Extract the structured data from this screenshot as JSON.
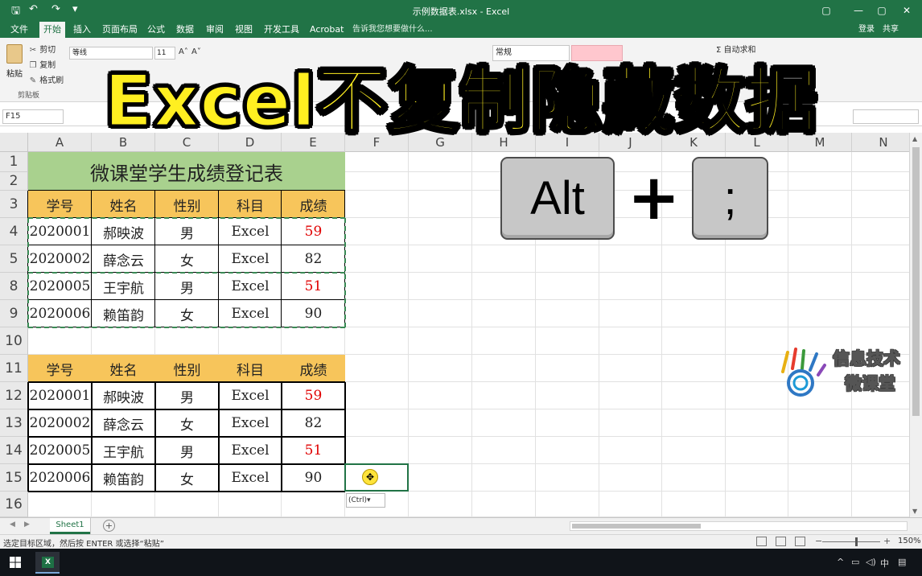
{
  "window": {
    "title": "示例数据表.xlsx - Excel",
    "restore_label": "▢",
    "min_label": "—",
    "close_label": "✕"
  },
  "quick_access": {
    "save": "🖫",
    "undo": "↶",
    "redo": "↷",
    "more": "▾"
  },
  "ribbon": {
    "tabs": [
      "文件",
      "开始",
      "插入",
      "页面布局",
      "公式",
      "数据",
      "审阅",
      "视图",
      "开发工具",
      "Acrobat"
    ],
    "active_tab": "开始",
    "tell_me": "告诉我您想要做什么...",
    "login": "登录",
    "share": "共享",
    "paste_label": "粘贴",
    "clipboard": [
      "剪切",
      "复制",
      "格式刷"
    ],
    "clipboard_group": "剪贴板",
    "font_name": "等线",
    "font_size": "11",
    "number_format": "常规",
    "autosum": "自动求和"
  },
  "overlay_title": "Excel不复制隐藏数据",
  "formula_bar": {
    "name_box": "F15"
  },
  "sheet": {
    "columns": [
      "A",
      "B",
      "C",
      "D",
      "E",
      "F",
      "G",
      "H",
      "I",
      "J",
      "K",
      "L",
      "M",
      "N"
    ],
    "rows": [
      "1",
      "2",
      "3",
      "4",
      "5",
      "8",
      "9",
      "10",
      "11",
      "12",
      "13",
      "14",
      "15",
      "16"
    ],
    "table_title": "微课堂学生成绩登记表",
    "headers": [
      "学号",
      "姓名",
      "性别",
      "科目",
      "成绩"
    ],
    "table1": [
      [
        "2020001",
        "郝映波",
        "男",
        "Excel",
        "59"
      ],
      [
        "2020002",
        "薛念云",
        "女",
        "Excel",
        "82"
      ],
      [
        "2020005",
        "王宇航",
        "男",
        "Excel",
        "51"
      ],
      [
        "2020006",
        "赖笛韵",
        "女",
        "Excel",
        "90"
      ]
    ],
    "table2": [
      [
        "2020001",
        "郝映波",
        "男",
        "Excel",
        "59"
      ],
      [
        "2020002",
        "薛念云",
        "女",
        "Excel",
        "82"
      ],
      [
        "2020005",
        "王宇航",
        "男",
        "Excel",
        "51"
      ],
      [
        "2020006",
        "赖笛韵",
        "女",
        "Excel",
        "90"
      ]
    ],
    "failing_color": "#e00000",
    "header_color": "#f7c55b",
    "title_color": "#a9d18e",
    "paste_options": "(Ctrl)▾"
  },
  "keys": {
    "alt": "Alt",
    "plus": "+",
    "semicolon": ";"
  },
  "watermark": {
    "line1": "信息技术",
    "line2": "微课堂"
  },
  "sheet_tabs": {
    "active": "Sheet1",
    "add_label": "+"
  },
  "status": {
    "message": "选定目标区域，然后按 ENTER 或选择“粘贴”",
    "zoom": "150%"
  },
  "taskbar": {
    "excel_label": "X",
    "ime": "中"
  }
}
